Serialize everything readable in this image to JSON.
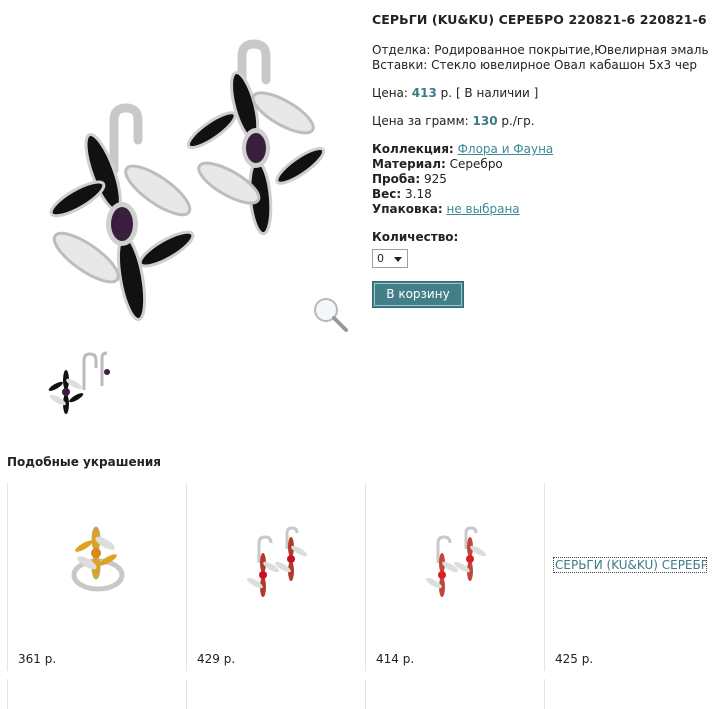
{
  "product": {
    "title": "СЕРЬГИ (KU&KU) СЕРЕБРО 220821-6 220821-6",
    "finish_label": "Отделка:",
    "finish_value": "Родированное покрытие,Ювелирная эмаль",
    "inserts_label": "Вставки:",
    "inserts_value": "Стекло ювелирное Овал кабашон 5х3 чер",
    "price_label": "Цена:",
    "price_value": "413",
    "price_unit": "р.",
    "availability": "[ В наличии ]",
    "price_per_gram_label": "Цена за грамм:",
    "price_per_gram_value": "130",
    "price_per_gram_unit": "р./гр.",
    "collection_label": "Коллекция:",
    "collection_value": "Флора и Фауна",
    "material_label": "Материал:",
    "material_value": "Серебро",
    "probe_label": "Проба:",
    "probe_value": "925",
    "weight_label": "Вес:",
    "weight_value": "3.18",
    "packaging_label": "Упаковка:",
    "packaging_value": "не выбрана",
    "quantity_label": "Количество:",
    "quantity_value": "0",
    "cart_button": "В корзину"
  },
  "similar": {
    "title": "Подобные украшения",
    "items": [
      {
        "price": "361 р."
      },
      {
        "price": "429 р."
      },
      {
        "price": "414 р."
      },
      {
        "link": "СЕРЬГИ (KU&KU) СЕРЕБРО",
        "price": "425 р."
      }
    ]
  },
  "colors": {
    "accent": "#427f89",
    "link": "#3b8a96",
    "enamel_black": "#111111",
    "stone": "#3a1e3e",
    "red_enamel": "#b23a2c",
    "yellow_enamel": "#e0a21a"
  },
  "icons": [
    "zoom-magnifier-icon",
    "dropdown-arrow-icon"
  ]
}
